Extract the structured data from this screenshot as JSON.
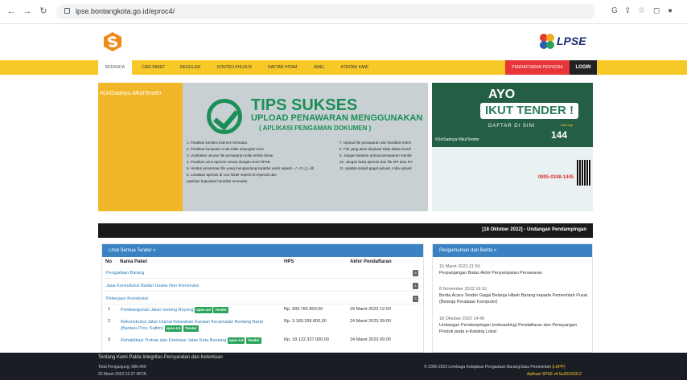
{
  "browser": {
    "url": "lpse.bontangkota.go.id/eproc4/"
  },
  "brand": {
    "lpse": "LPSE"
  },
  "menu": {
    "items": [
      "BERANDA",
      "CARI PAKET",
      "REGULASI",
      "KONTEN KHUSUS",
      "DAFTAR HITAM",
      "AMEL",
      "KONTAK KAMI"
    ],
    "register": "PENDAFTARAN PENYEDIA",
    "login": "LOGIN"
  },
  "banner": {
    "hashtag": "#UniSadnya #IkutTender",
    "title": "TIPS SUKSES",
    "subtitle": "UPLOAD PENAWARAN MENGGUNAKAN",
    "subtitle2": "( APLIKASI PENGAMAN DOKUMEN )",
    "tips_left": [
      "1. Pastikan koneksi internet memadai.",
      "2. Pastikan komputer Anda tidak terjangkiti virus.",
      "3. Usahakan ukuran file penawaran tidak terlalu besar.",
      "4. Pastikan versi apendo sesuai dengan versi SPSE.",
      "5. Hindari penamaan file yang mengandung karakter aneh seperti ~,*, #,!,(,). dll",
      "6. Letakkan apendo di root folder seperti D:/Apendo dan",
      "pastikan kapasitas harddisk memadai."
    ],
    "tips_right": [
      "7. Upload file penawaran dari harddisk intern",
      "8. File yang akan diupload tidak dalam kondi",
      "9. Jangan lakukan upload penawaran mende",
      "10. Jangan buka apendo dari file ZIP atau RA",
      "11. Apabila terjadi gagal upload, coba upload"
    ]
  },
  "ad": {
    "ayo": "AYO",
    "ikut": "IKUT TENDER !",
    "daftar": "DAFTAR DI SINI",
    "hashtag": "#UniSadnya #IkutTender",
    "hubungi": "Hubungi",
    "number": "144",
    "phone": "0895-0348-1445"
  },
  "ticker": {
    "text": "[18 Oktober 2022] - Undangan Pendampingan"
  },
  "tender": {
    "header": "Lihat Semua Tender »",
    "columns": [
      "No",
      "Nama Paket",
      "HPS",
      "Akhir Pendaftaran"
    ],
    "categories": [
      {
        "name": "Pengadaan Barang",
        "count": "6"
      },
      {
        "name": "Jasa Konsultansi Badan Usaha Non Konstruksi",
        "count": "1"
      },
      {
        "name": "Pekerjaan Konstruksi",
        "count": "5"
      }
    ],
    "rows": [
      {
        "no": "1",
        "name": "Pembangunan Jalan Gotong Royong",
        "spse": "spse 4.5",
        "tag": "Tender",
        "hps": "Rp. 999.782.800,00",
        "akhir": "29 Maret 2023 12:00"
      },
      {
        "no": "2",
        "name": "Rekonstruksi Jalan Damai Kelurahan Kanaan Kecamatan Bontang Barat (Bankeu Prov. Kaltim)",
        "spse": "spse 4.5",
        "tag": "Tender",
        "hps": "Rp. 3.183.336.800,00",
        "akhir": "24 Maret 2023 09:00"
      },
      {
        "no": "3",
        "name": "Rehabilitasi Trotoar dan Drainase Jalan Kota Bontang",
        "spse": "spse 4.5",
        "tag": "Tender",
        "hps": "Rp. 18.122.327.000,00",
        "akhir": "24 Maret 2023 09:00"
      }
    ]
  },
  "news": {
    "header": "Pengumuman dan Berita »",
    "items": [
      {
        "date": "15 Maret 2023 21:50",
        "title": "Perpanjangan Batas Akhir Penyampaian Penawaran"
      },
      {
        "date": "8 November 2022 16:10",
        "title": "Berita Acara Tender Gagal Belanja Hibah Barang kepada Pemerintah Pusat (Belanja Peralatan Komputer)"
      },
      {
        "date": "18 Oktober 2022 14:45",
        "title": "Undangan Pendampingan (onboarding) Pendaftaran dan Penayangan Produk pada e-Katalog Lokal"
      }
    ]
  },
  "footer": {
    "links": [
      "Tentang Kami",
      "Pakta Integritas",
      "Persyaratan dan Ketentuan"
    ],
    "visitors": "Total Pengunjung: 689.400",
    "datetime": "23 Maret 2023 22:27 WITA",
    "copyright": "© 2006-2023 Lembaga Kebijakan Pengadaan Barang/Jasa Pemerintah",
    "lkpp": "(LKPP)",
    "version": "Aplikasi SPSE v4.5u20230313"
  },
  "colors": {
    "yellow": "#f7c928",
    "green": "#1b8f55",
    "blue": "#3a82c4",
    "footer": "#1a1d24"
  }
}
